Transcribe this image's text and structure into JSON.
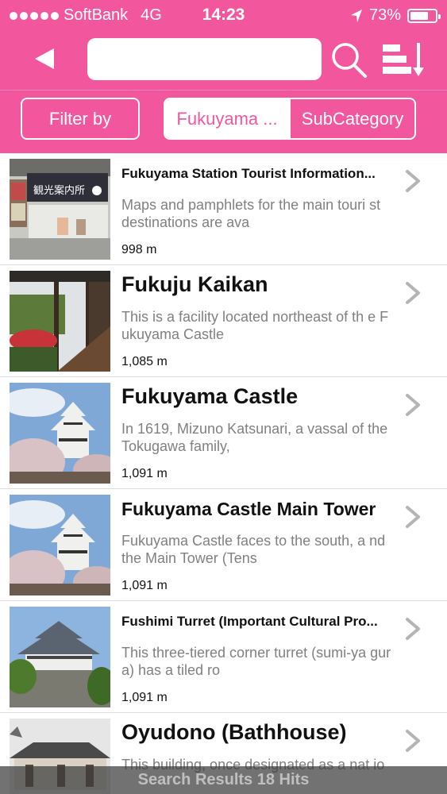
{
  "status_bar": {
    "carrier": "SoftBank",
    "network": "4G",
    "time": "14:23",
    "battery": "73%",
    "battery_level": 0.73
  },
  "nav": {
    "back_icon": "back-arrow-icon",
    "search_value": "",
    "search_icon": "search-icon",
    "sort_icon": "sort-icon"
  },
  "filters": {
    "filter_label": "Filter by",
    "area_label": "Fukuyama ...",
    "subcategory_label": "SubCategory"
  },
  "colors": {
    "accent": "#f2579e",
    "text_secondary": "#808080"
  },
  "items": [
    {
      "title": "Fukuyama Station Tourist Information...",
      "title_size": "small",
      "description": "Maps and pamphlets for the main touri st destinations are ava",
      "distance": "998 m",
      "image_sign_text": "観光案内所"
    },
    {
      "title": "Fukuju Kaikan",
      "title_size": "large",
      "description": "This is a facility located northeast of th e Fukuyama Castle",
      "distance": "1,085 m"
    },
    {
      "title": "Fukuyama Castle",
      "title_size": "large",
      "description": "In 1619, Mizuno Katsunari, a vassal of the Tokugawa family,",
      "distance": "1,091 m"
    },
    {
      "title": "Fukuyama Castle Main Tower",
      "title_size": "large",
      "description": "Fukuyama Castle faces to the south, a nd the Main Tower (Tens",
      "distance": "1,091 m"
    },
    {
      "title": "Fushimi Turret (Important Cultural Pro...",
      "title_size": "small",
      "description": "This three-tiered corner turret (sumi-ya gura) has a tiled ro",
      "distance": "1,091 m"
    },
    {
      "title": "Oyudono (Bathhouse)",
      "title_size": "large",
      "description": "This building, once designated as a nat io",
      "distance": ""
    }
  ],
  "results": {
    "text": "Search Results 18 Hits"
  }
}
